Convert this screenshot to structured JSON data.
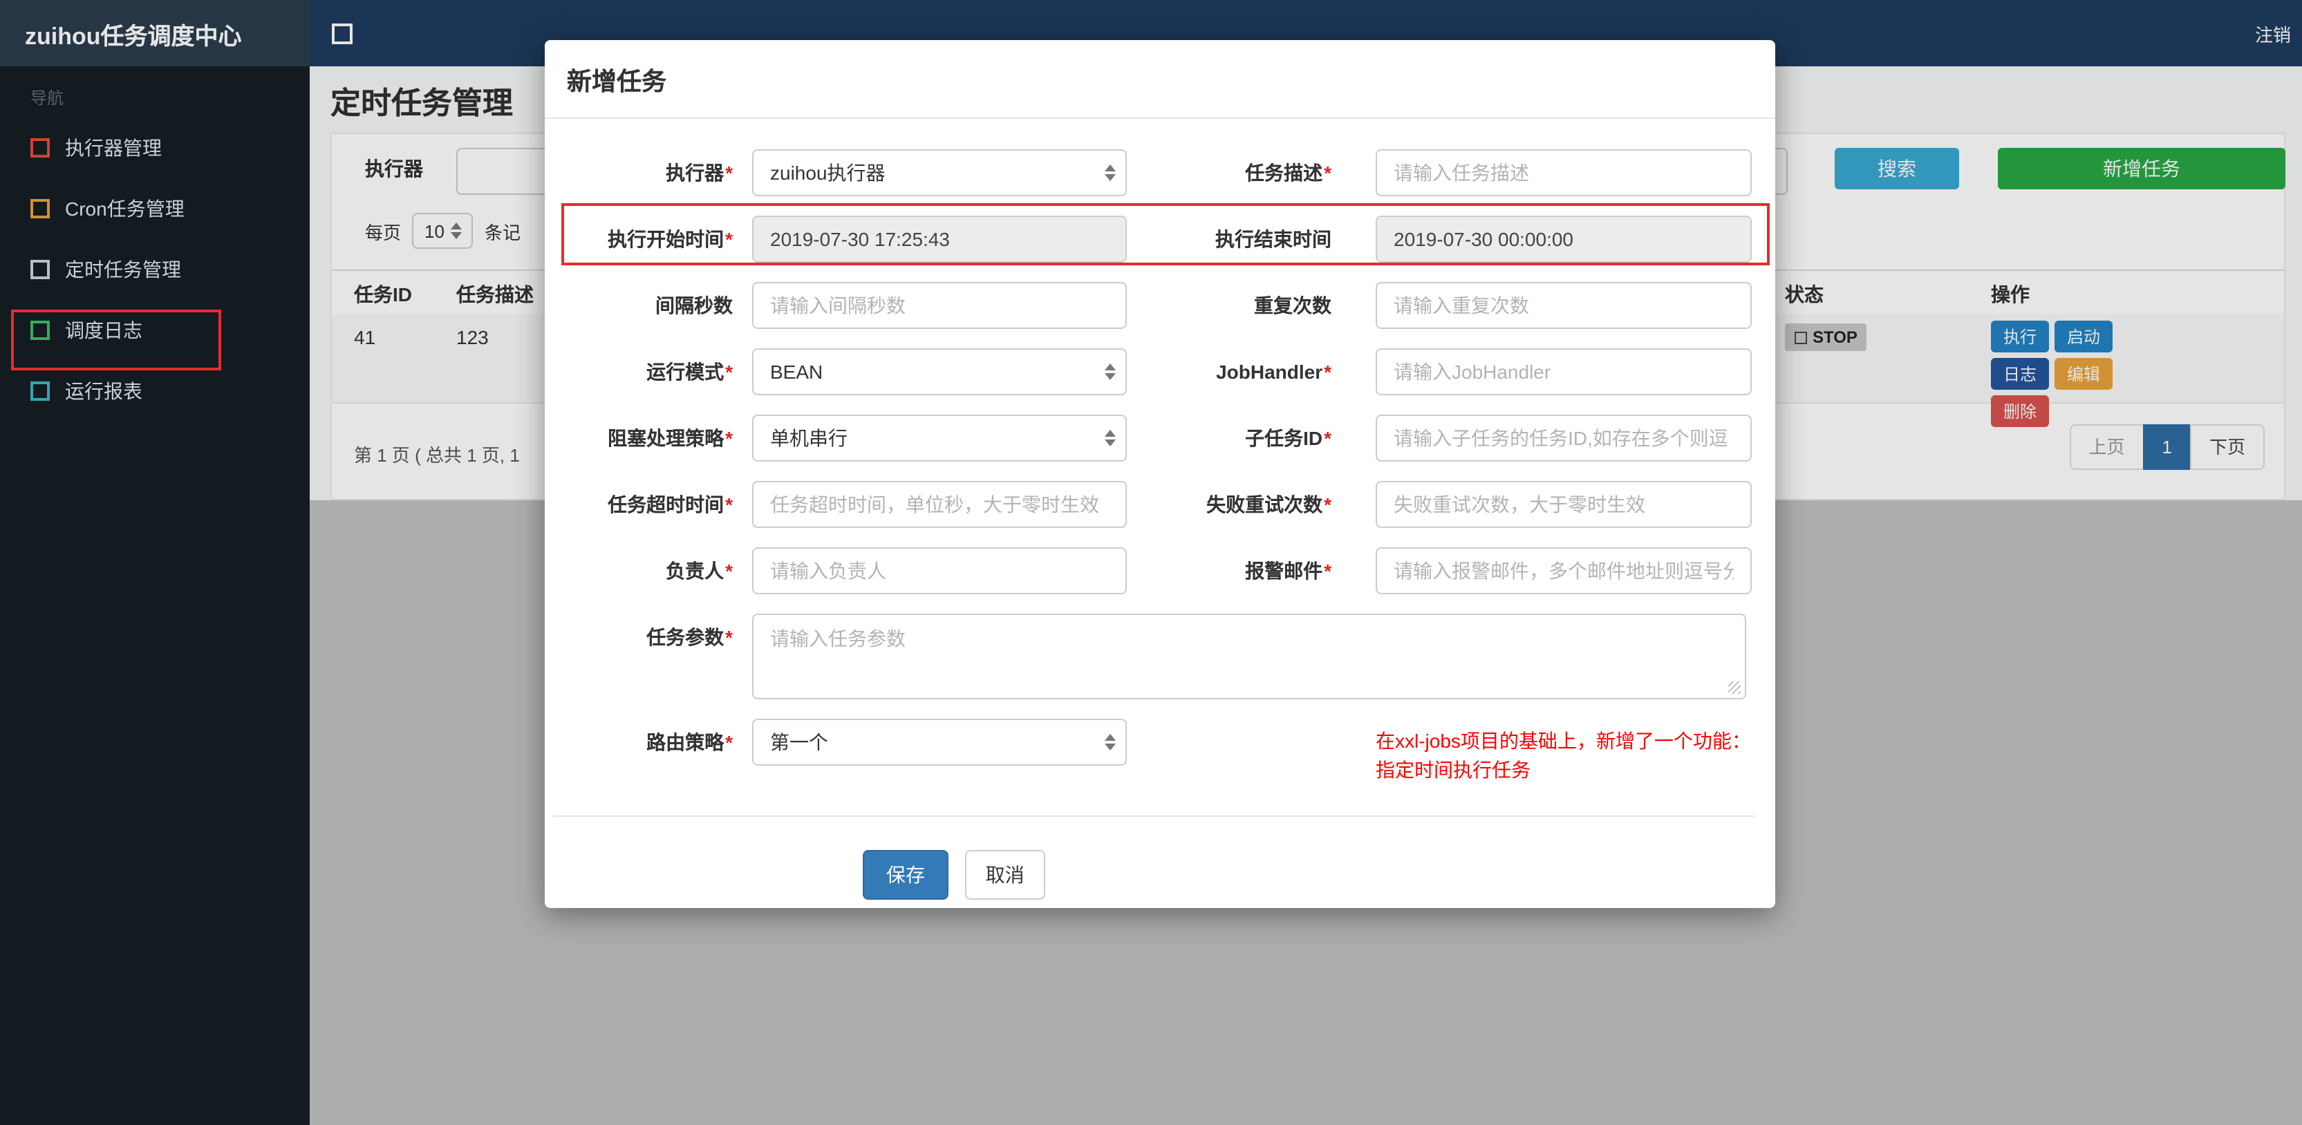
{
  "navbar": {
    "brand": "zuihou任务调度中心",
    "menu_icon": "square-outline-icon",
    "logout": "注销"
  },
  "sidebar": {
    "section": "导航",
    "items": [
      {
        "label": "执行器管理",
        "icon": "square-outline-icon",
        "icon_color": "#e74c3c"
      },
      {
        "label": "Cron任务管理",
        "icon": "square-outline-icon",
        "icon_color": "#e8a33d"
      },
      {
        "label": "定时任务管理",
        "icon": "square-outline-icon",
        "icon_color": "#cdd5dd"
      },
      {
        "label": "调度日志",
        "icon": "square-outline-icon",
        "icon_color": "#3fbf67"
      },
      {
        "label": "运行报表",
        "icon": "square-outline-icon",
        "icon_color": "#3bb8c4"
      }
    ]
  },
  "page": {
    "title": "定时任务管理",
    "toolbar": {
      "executor_label": "执行器",
      "search_button": "搜索",
      "add_button": "新增任务"
    },
    "perpage": {
      "prefix": "每页",
      "value": "10",
      "suffix": "条记"
    },
    "table": {
      "headers": {
        "id": "任务ID",
        "desc": "任务描述",
        "status": "状态",
        "actions": "操作"
      },
      "row": {
        "id": "41",
        "desc": "123",
        "status": "STOP",
        "btn_execute": "执行",
        "btn_start": "启动",
        "btn_log": "日志",
        "btn_edit": "编辑",
        "btn_delete": "删除"
      }
    },
    "summary": "第 1 页 ( 总共 1 页, 1",
    "pagination": {
      "prev": "上页",
      "current": "1",
      "next": "下页"
    }
  },
  "modal": {
    "title": "新增任务",
    "required_mark": "*",
    "rows": [
      {
        "left": {
          "label": "执行器",
          "type": "select",
          "value": "zuihou执行器"
        },
        "right": {
          "label": "任务描述",
          "type": "text",
          "placeholder": "请输入任务描述"
        }
      },
      {
        "left": {
          "label": "执行开始时间",
          "type": "readonly",
          "value": "2019-07-30 17:25:43"
        },
        "right": {
          "label": "执行结束时间",
          "type": "readonly",
          "value": "2019-07-30 00:00:00"
        }
      },
      {
        "left": {
          "label": "间隔秒数",
          "type": "text",
          "placeholder": "请输入间隔秒数"
        },
        "right": {
          "label": "重复次数",
          "type": "text",
          "placeholder": "请输入重复次数"
        }
      },
      {
        "left": {
          "label": "运行模式",
          "type": "select",
          "value": "BEAN"
        },
        "right": {
          "label": "JobHandler",
          "type": "text",
          "placeholder": "请输入JobHandler"
        }
      },
      {
        "left": {
          "label": "阻塞处理策略",
          "type": "select",
          "value": "单机串行"
        },
        "right": {
          "label": "子任务ID",
          "type": "text",
          "placeholder": "请输入子任务的任务ID,如存在多个则逗"
        }
      },
      {
        "left": {
          "label": "任务超时时间",
          "type": "text",
          "placeholder": "任务超时时间，单位秒，大于零时生效"
        },
        "right": {
          "label": "失败重试次数",
          "type": "text",
          "placeholder": "失败重试次数，大于零时生效"
        }
      },
      {
        "left": {
          "label": "负责人",
          "type": "text",
          "placeholder": "请输入负责人"
        },
        "right": {
          "label": "报警邮件",
          "type": "text",
          "placeholder": "请输入报警邮件，多个邮件地址则逗号分"
        }
      }
    ],
    "params": {
      "label": "任务参数",
      "placeholder": "请输入任务参数"
    },
    "route": {
      "label": "路由策略",
      "value": "第一个"
    },
    "note": {
      "line1": "在xxl-jobs项目的基础上，新增了一个功能：",
      "line2": "指定时间执行任务",
      "color": "#ff0000"
    },
    "buttons": {
      "save": "保存",
      "cancel": "取消"
    }
  },
  "colors": {
    "navbar": "#1e3c5f",
    "sidebar": "#161e24",
    "search_button": "#39a9d2",
    "add_button": "#28a745",
    "save_button": "#337ab7",
    "annotation": "#e82c2c",
    "status_badge": "#c8c8c8"
  }
}
